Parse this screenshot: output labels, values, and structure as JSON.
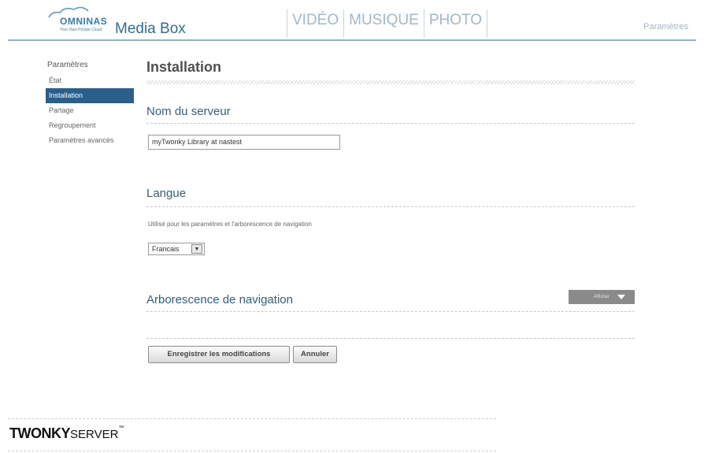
{
  "header": {
    "brand_name": "OMNINAS",
    "brand_tagline": "Your Own Private Cloud",
    "app_title": "Media Box",
    "nav_tabs": [
      {
        "label": "VIDÉO"
      },
      {
        "label": "MUSIQUE"
      },
      {
        "label": "PHOTO"
      }
    ],
    "settings_link": "Paramètres"
  },
  "sidebar": {
    "title": "Paramètres",
    "items": [
      {
        "label": "État",
        "active": false
      },
      {
        "label": "Installation",
        "active": true
      },
      {
        "label": "Partage",
        "active": false
      },
      {
        "label": "Regroupement",
        "active": false
      },
      {
        "label": "Paramètres avancés",
        "active": false
      }
    ]
  },
  "main": {
    "page_title": "Installation",
    "server_name": {
      "title": "Nom du serveur",
      "value": "myTwonky Library at nastest"
    },
    "language": {
      "title": "Langue",
      "hint": "Utilisé pour les paramètres et l'arborescence de navigation",
      "selected": "Francais"
    },
    "navigation_tree": {
      "title": "Arborescence de navigation",
      "dropdown_label": "Afficher"
    },
    "buttons": {
      "save": "Enregistrer les modifications",
      "cancel": "Annuler"
    }
  },
  "footer": {
    "brand_bold": "TWONKY",
    "brand_light": "SERVER",
    "brand_mark": "™"
  },
  "colors": {
    "accent": "#2a5f8c",
    "section_title": "#2f5f86",
    "nav_tab": "#9fb8c9",
    "header_rule": "#8fb4cc"
  }
}
